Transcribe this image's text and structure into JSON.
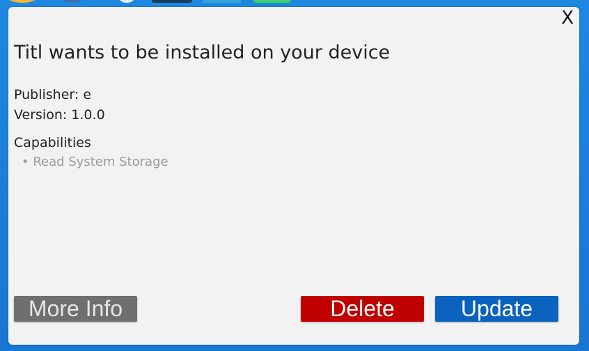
{
  "window": {
    "close_label": "X"
  },
  "dialog": {
    "title": "Titl wants to be installed on your device",
    "publisher": "Publisher: e",
    "version": "Version: 1.0.0",
    "capabilities_heading": "Capabilities",
    "capabilities": [
      "• Read System Storage"
    ]
  },
  "buttons": {
    "more_info": "More Info",
    "delete": "Delete",
    "update": "Update"
  },
  "colors": {
    "more_info_bg": "#6f6f6f",
    "delete_bg": "#c00000",
    "update_bg": "#0a62be",
    "dialog_bg": "#f2f2f2",
    "desktop_bg": "#1e88e0"
  },
  "icons": {
    "close": "close-icon"
  }
}
